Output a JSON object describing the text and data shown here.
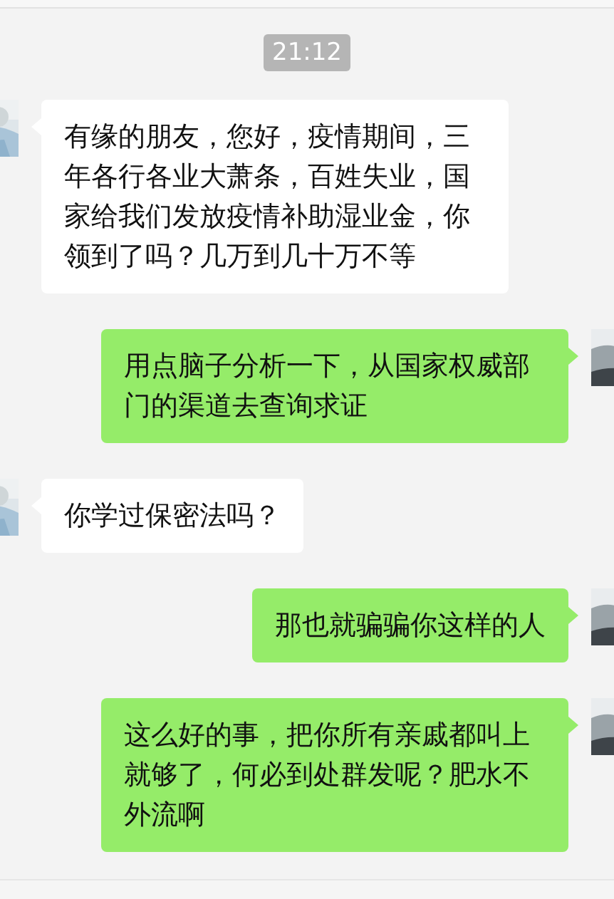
{
  "timestamp": "21:12",
  "messages": [
    {
      "kind": "received",
      "text": "有缘的朋友，您好，疫情期间，三年各行各业大萧条，百姓失业，国家给我们发放疫情补助湿业金，你领到了吗？几万到几十万不等"
    },
    {
      "kind": "sent",
      "text": "用点脑子分析一下，从国家权威部门的渠道去查询求证"
    },
    {
      "kind": "received",
      "text": "你学过保密法吗？"
    },
    {
      "kind": "sent",
      "text": "那也就骗骗你这样的人"
    },
    {
      "kind": "sent",
      "text": "这么好的事，把你所有亲戚都叫上就够了，何必到处群发呢？肥水不外流啊"
    }
  ]
}
